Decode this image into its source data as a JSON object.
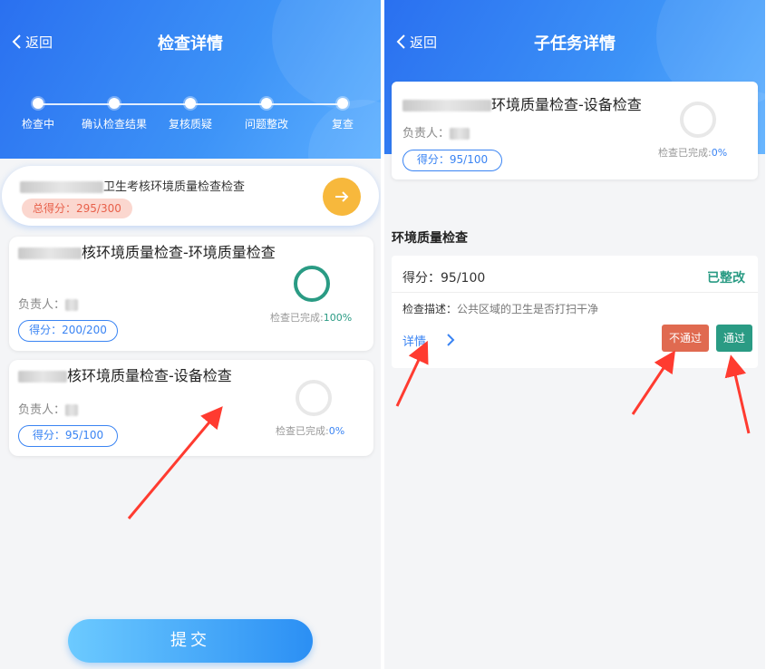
{
  "left": {
    "back_label": "返回",
    "title": "检查详情",
    "steps": [
      "检查中",
      "确认检查结果",
      "复核质疑",
      "问题整改",
      "复查"
    ],
    "summary": {
      "title": "卫生考核环境质量检查检查",
      "total_score": "总得分：295/300"
    },
    "tasks": [
      {
        "name": "核环境质量检查-环境质量检查",
        "owner": "负责人：",
        "score": "得分：200/200",
        "progress_label": "检查已完成:",
        "progress_value": "100%"
      },
      {
        "name": "核环境质量检查-设备检查",
        "owner": "负责人：",
        "score": "得分：95/100",
        "progress_label": "检查已完成:",
        "progress_value": "0%"
      }
    ],
    "submit_label": "提交"
  },
  "right": {
    "back_label": "返回",
    "title": "子任务详情",
    "card": {
      "name": "环境质量检查-设备检查",
      "owner": "负责人：",
      "score": "得分：95/100",
      "progress_label": "检查已完成:",
      "progress_value": "0%"
    },
    "section_title": "环境质量检查",
    "item": {
      "score": "得分：95/100",
      "status": "已整改",
      "desc_label": "检查描述：",
      "desc_value": "公共区域的卫生是否打扫干净",
      "detail_label": "详情",
      "fail_label": "不通过",
      "pass_label": "通过"
    }
  },
  "colors": {
    "primary": "#3a84f3",
    "success": "#2a9b84",
    "danger": "#e06a50",
    "warning": "#f7b83c",
    "annotation": "#ff3b30"
  },
  "icons": {
    "back": "chevron-left-icon",
    "arrow": "arrow-right-icon",
    "detail": "chevron-right-icon"
  }
}
